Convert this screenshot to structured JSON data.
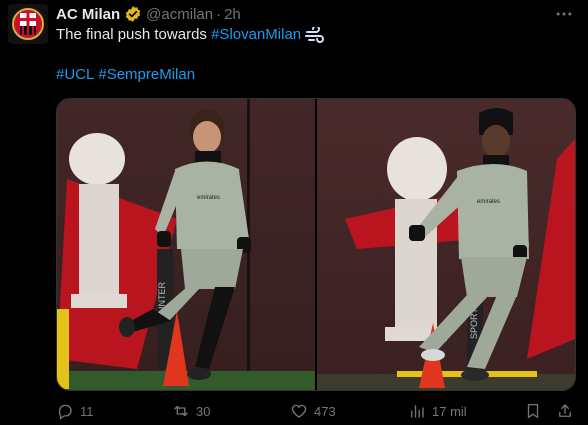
{
  "post": {
    "author_name": "AC Milan",
    "handle": "@acmilan",
    "separator": "·",
    "time": "2h",
    "text_prefix": "The final push towards ",
    "text_hashtag": "#SlovanMilan",
    "hashtags": [
      "#UCL",
      "#SempreMilan"
    ]
  },
  "icons": {
    "verified": "verified-badge-icon",
    "more": "more-options-icon",
    "dash": "dashing-away-emoji",
    "reply": "reply-icon",
    "repost": "repost-icon",
    "like": "like-icon",
    "views": "views-icon",
    "bookmark": "bookmark-icon",
    "share": "share-icon"
  },
  "metrics": {
    "replies": "11",
    "reposts": "30",
    "likes": "473",
    "views": "17 mil"
  },
  "colors": {
    "background": "#000000",
    "text": "#e7e9ea",
    "muted": "#71767b",
    "link": "#1d9bf0",
    "verified_gold": "#e2b719"
  }
}
